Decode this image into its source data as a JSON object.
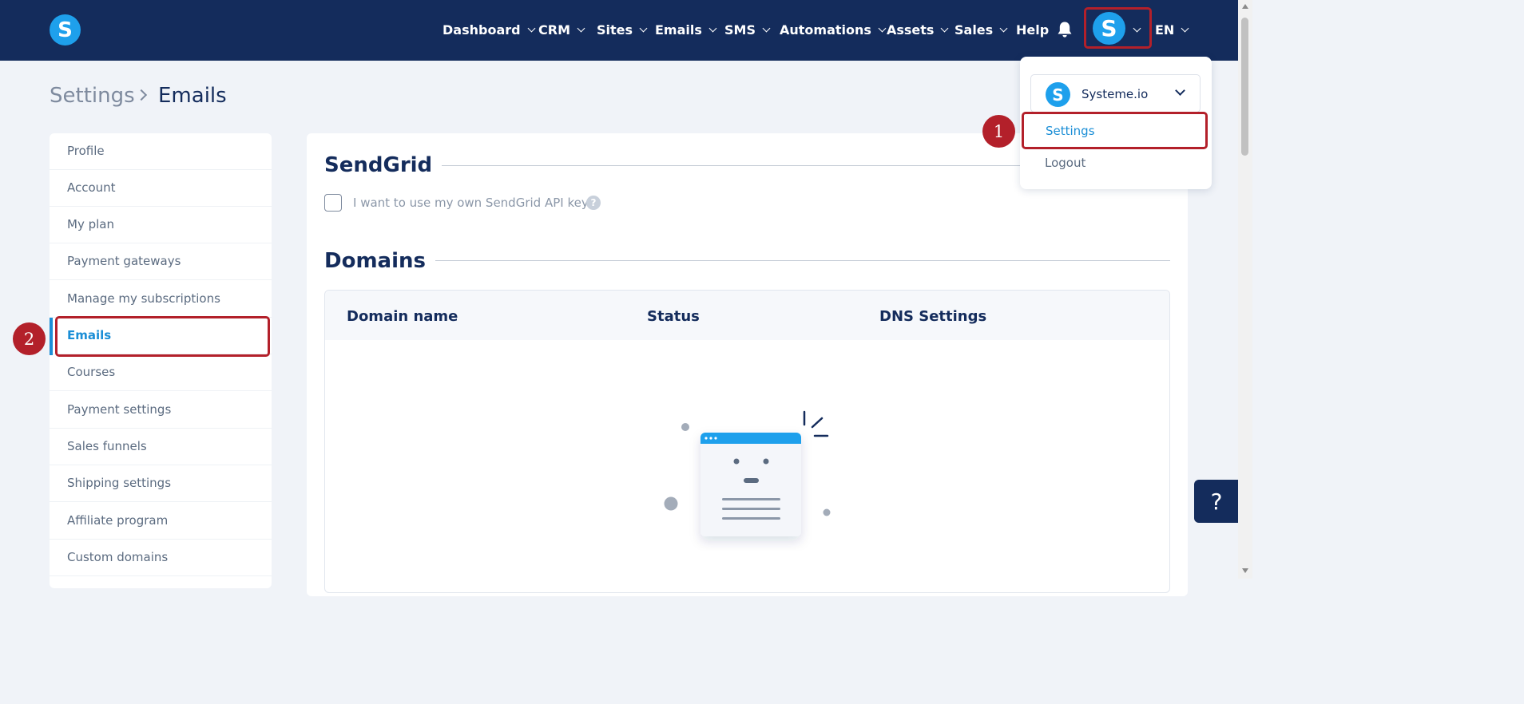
{
  "brand": {
    "logo_letter": "S"
  },
  "nav": {
    "items": [
      {
        "label": "Dashboard"
      },
      {
        "label": "CRM"
      },
      {
        "label": "Sites"
      },
      {
        "label": "Emails"
      },
      {
        "label": "SMS"
      },
      {
        "label": "Automations"
      },
      {
        "label": "Assets"
      },
      {
        "label": "Sales"
      },
      {
        "label": "Help"
      }
    ],
    "avatar_letter": "S",
    "language": "EN"
  },
  "dropdown": {
    "workspace_logo_letter": "S",
    "workspace_name": "Systeme.io",
    "settings_label": "Settings",
    "logout_label": "Logout"
  },
  "markers": {
    "one": "1",
    "two": "2"
  },
  "breadcrumb": {
    "root": "Settings",
    "current": "Emails"
  },
  "sidebar": {
    "items": [
      {
        "label": "Profile"
      },
      {
        "label": "Account"
      },
      {
        "label": "My plan"
      },
      {
        "label": "Payment gateways"
      },
      {
        "label": "Manage my subscriptions"
      },
      {
        "label": "Emails"
      },
      {
        "label": "Courses"
      },
      {
        "label": "Payment settings"
      },
      {
        "label": "Sales funnels"
      },
      {
        "label": "Shipping settings"
      },
      {
        "label": "Affiliate program"
      },
      {
        "label": "Custom domains"
      }
    ],
    "active_index": 5
  },
  "sendgrid": {
    "title": "SendGrid",
    "checkbox_label": "I want to use my own SendGrid API key",
    "help_glyph": "?"
  },
  "domains": {
    "title": "Domains",
    "columns": [
      "Domain name",
      "Status",
      "DNS Settings"
    ]
  },
  "float_help": {
    "glyph": "?"
  },
  "colors": {
    "navy": "#142c5c",
    "accent_blue": "#1b8ed6",
    "logo_blue": "#1ea0ec",
    "highlight_red": "#b3202a"
  },
  "icons": [
    "logo-icon",
    "chevron-down-icon",
    "bell-icon",
    "avatar",
    "empty-state-illustration",
    "help-icon"
  ]
}
